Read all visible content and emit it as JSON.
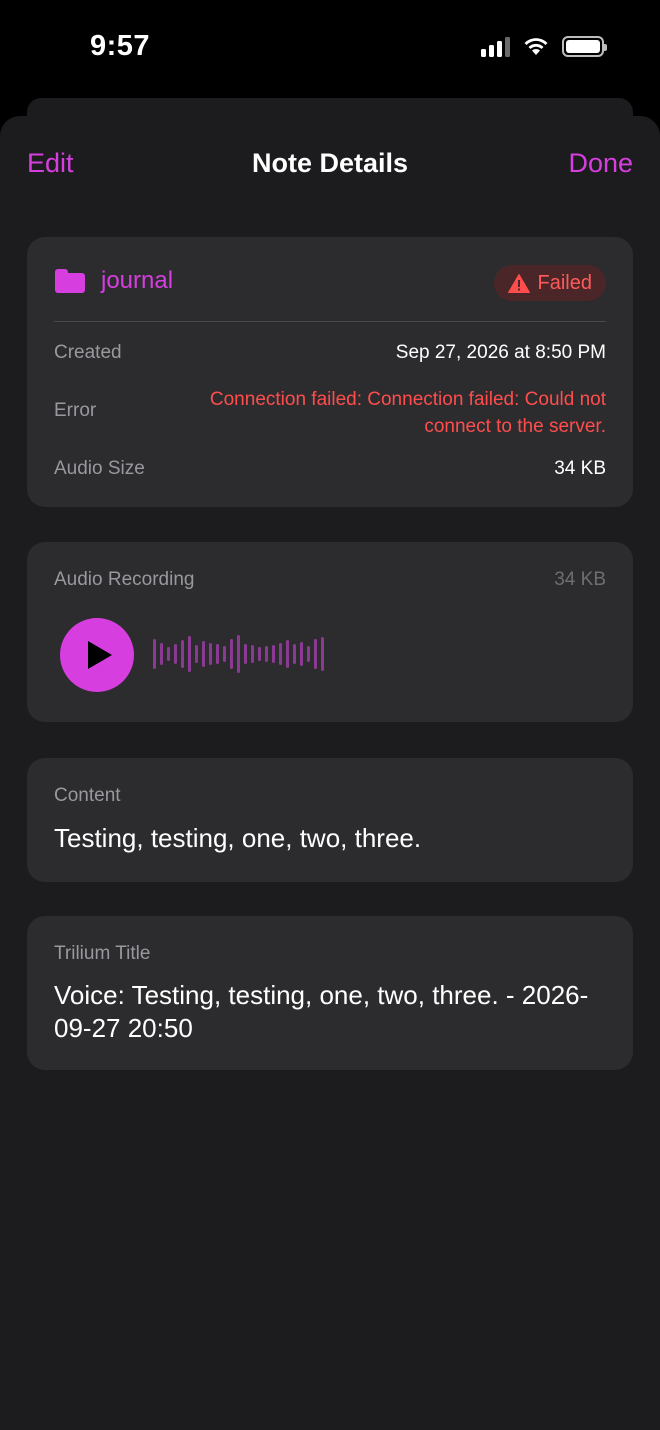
{
  "status_bar": {
    "time": "9:57"
  },
  "nav": {
    "edit_label": "Edit",
    "title": "Note Details",
    "done_label": "Done"
  },
  "info": {
    "folder": "journal",
    "status": "Failed",
    "rows": {
      "created_label": "Created",
      "created_value": "Sep 27, 2026 at 8:50 PM",
      "error_label": "Error",
      "error_value": "Connection failed: Connection failed: Could not connect to the server.",
      "audio_size_label": "Audio Size",
      "audio_size_value": "34 KB"
    }
  },
  "audio": {
    "label": "Audio Recording",
    "size": "34 KB"
  },
  "content": {
    "label": "Content",
    "text": "Testing, testing, one, two, three."
  },
  "trilium": {
    "label": "Trilium Title",
    "text": "Voice: Testing, testing, one, two, three. - 2026-09-27 20:50"
  },
  "colors": {
    "accent": "#d63ee0",
    "error": "#ff4d4d",
    "card": "#2c2c2e",
    "sheet": "#1c1c1e"
  },
  "icons": [
    "signal-icon",
    "wifi-icon",
    "battery-icon",
    "folder-icon",
    "warning-icon",
    "play-icon"
  ]
}
